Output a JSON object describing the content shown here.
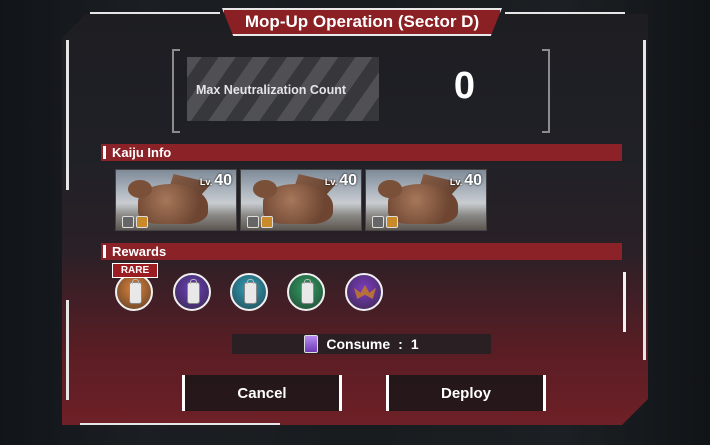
{
  "title": "Mop-Up Operation (Sector D)",
  "neutralization": {
    "label": "Max Neutralization Count",
    "value": "0"
  },
  "kaiju_section": {
    "label": "Kaiju Info",
    "cards": [
      {
        "level_prefix": "Lv.",
        "level": "40"
      },
      {
        "level_prefix": "Lv.",
        "level": "40"
      },
      {
        "level_prefix": "Lv.",
        "level": "40"
      }
    ]
  },
  "rewards_section": {
    "label": "Rewards",
    "rare_badge": "RARE",
    "items": [
      {
        "icon": "lantern-icon",
        "color": "#e0833a"
      },
      {
        "icon": "lantern-icon",
        "color": "#6a3fb8"
      },
      {
        "icon": "lantern-icon",
        "color": "#2fa3bf"
      },
      {
        "icon": "lantern-icon",
        "color": "#2e9e62"
      },
      {
        "icon": "bat-icon",
        "color": "#7b3cbf"
      }
    ]
  },
  "consume": {
    "label": "Consume",
    "separator": ":",
    "value": "1"
  },
  "buttons": {
    "cancel": "Cancel",
    "deploy": "Deploy"
  }
}
